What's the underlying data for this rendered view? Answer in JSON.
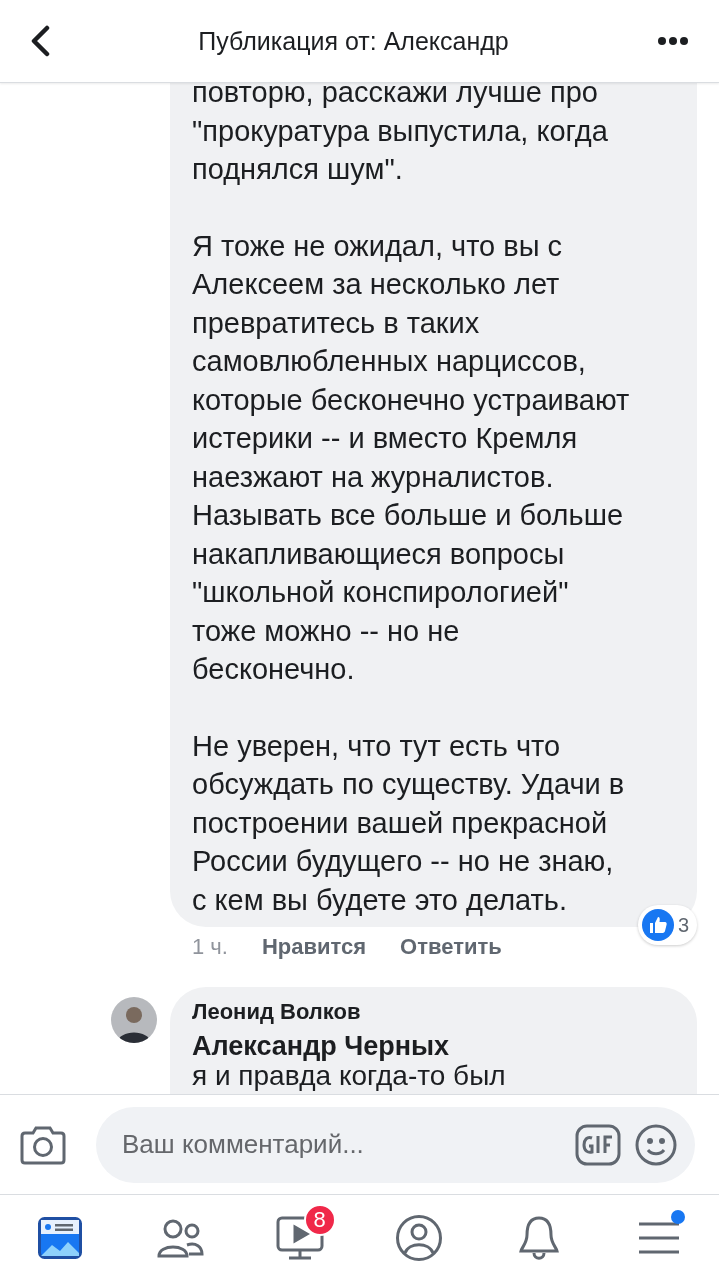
{
  "header": {
    "title": "Публикация от: Александр"
  },
  "comment": {
    "paragraphs": [
      "повторю, расскажи лучше про\n\"прокуратура выпустила, когда\nподнялся шум\".",
      "Я тоже не ожидал, что вы с\nАлексеем за несколько лет\nпревратитесь в таких\nсамовлюбленных нарциссов,\nкоторые бесконечно устраивают\nистерики -- и вместо Кремля\nнаезжают на журналистов.\nНазывать все больше и больше\nнакапливающиеся вопросы\n\"школьной конспирологией\"\nтоже можно -- но не\nбесконечно.",
      "Не уверен, что тут есть что\nобсуждать по существу. Удачи в\nпостроении вашей прекрасной\nРоссии будущего -- но не знаю,\nс кем вы будете это делать."
    ],
    "time": "1 ч.",
    "actions": [
      "Нравится",
      "Ответить"
    ],
    "reaction_count": "3"
  },
  "reply": {
    "author": "Леонид Волков",
    "mention": "Александр Черных",
    "text": "я и правда когда-то был"
  },
  "composer": {
    "placeholder": "Ваш комментарий..."
  },
  "nav": [
    {
      "kind": "feed",
      "selected": true
    },
    {
      "kind": "friends",
      "selected": false
    },
    {
      "kind": "video",
      "selected": false,
      "badge": "8"
    },
    {
      "kind": "profile",
      "selected": false
    },
    {
      "kind": "notifications",
      "selected": false
    },
    {
      "kind": "menu",
      "selected": false,
      "dot": true
    }
  ]
}
